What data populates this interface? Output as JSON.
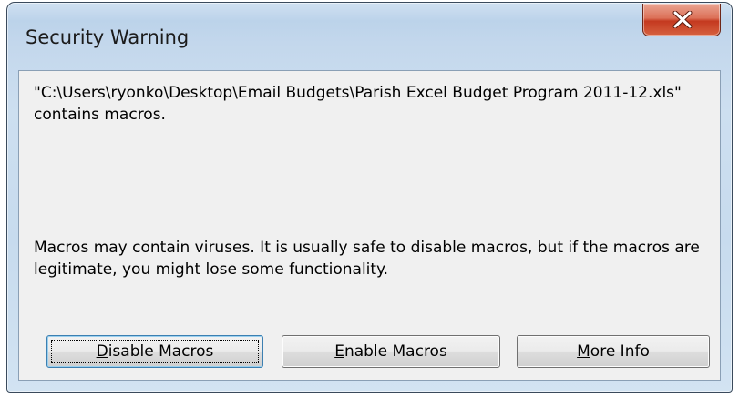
{
  "window": {
    "title": "Security Warning",
    "close_icon": "close-x-icon",
    "accent_close_color": "#c4391f"
  },
  "dialog": {
    "message": "\"C:\\Users\\ryonko\\Desktop\\Email Budgets\\Parish Excel Budget Program 2011-12.xls\" contains macros.",
    "warning": "Macros may contain viruses. It is usually safe to disable macros, but if the macros are legitimate, you might lose some functionality."
  },
  "buttons": {
    "disable": {
      "mnemonic": "D",
      "rest": "isable Macros"
    },
    "enable": {
      "mnemonic": "E",
      "rest": "nable Macros"
    },
    "more_info": {
      "mnemonic": "M",
      "rest": "ore Info"
    }
  }
}
